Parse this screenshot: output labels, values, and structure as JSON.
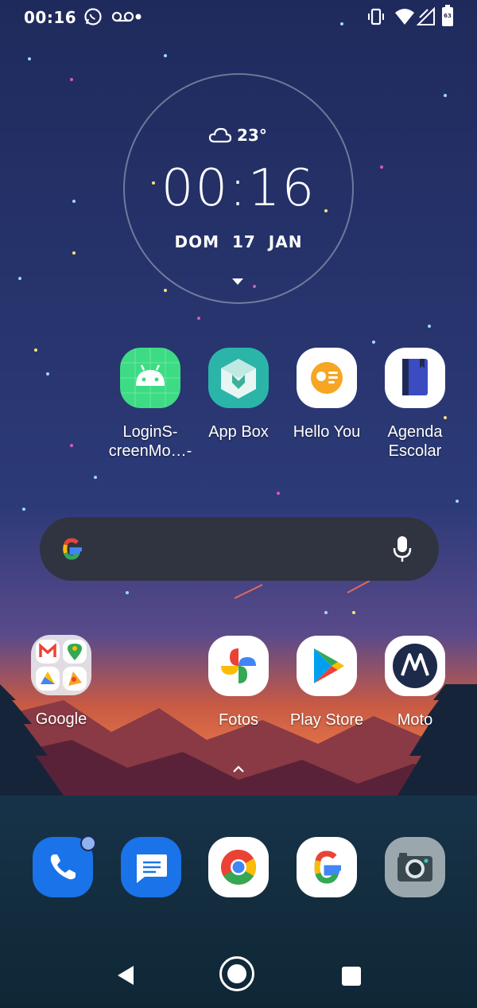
{
  "status_bar": {
    "time": "00:16",
    "left_icons": [
      "whatsapp-icon",
      "voicemail-icon",
      "dot-icon"
    ],
    "right_icons": [
      "vibrate-icon",
      "wifi-icon",
      "signal-icon",
      "battery-icon"
    ],
    "battery_level": "63"
  },
  "clock_widget": {
    "weather_icon": "cloud-icon",
    "temperature": "23°",
    "time": "00:16",
    "date": "DOM 17 JAN"
  },
  "row1_apps": [
    {
      "label": "LoginS-\ncreenMo…-",
      "icon": "android-icon"
    },
    {
      "label": "App Box",
      "icon": "app-box-icon"
    },
    {
      "label": "Hello You",
      "icon": "hello-you-icon"
    },
    {
      "label": "Agenda\nEscolar",
      "icon": "agenda-icon"
    }
  ],
  "search_bar": {
    "logo": "google-g-icon",
    "mic": "microphone-icon"
  },
  "row2_apps": [
    {
      "label": "Google",
      "icon": "google-folder-icon"
    },
    {
      "label": "Fotos",
      "icon": "google-photos-icon"
    },
    {
      "label": "Play Store",
      "icon": "play-store-icon"
    },
    {
      "label": "Moto",
      "icon": "motorola-icon"
    }
  ],
  "dock": [
    "phone-icon",
    "messages-icon",
    "chrome-icon",
    "google-app-icon",
    "camera-icon"
  ],
  "nav_bar": [
    "back-icon",
    "home-icon",
    "recents-icon"
  ],
  "colors": {
    "sky_top": "#1f2a5c",
    "sky_mid": "#2c3a78",
    "sunset": "#d8583a",
    "mountains": "#6b2b3a",
    "search_bg": "#2f3440"
  }
}
